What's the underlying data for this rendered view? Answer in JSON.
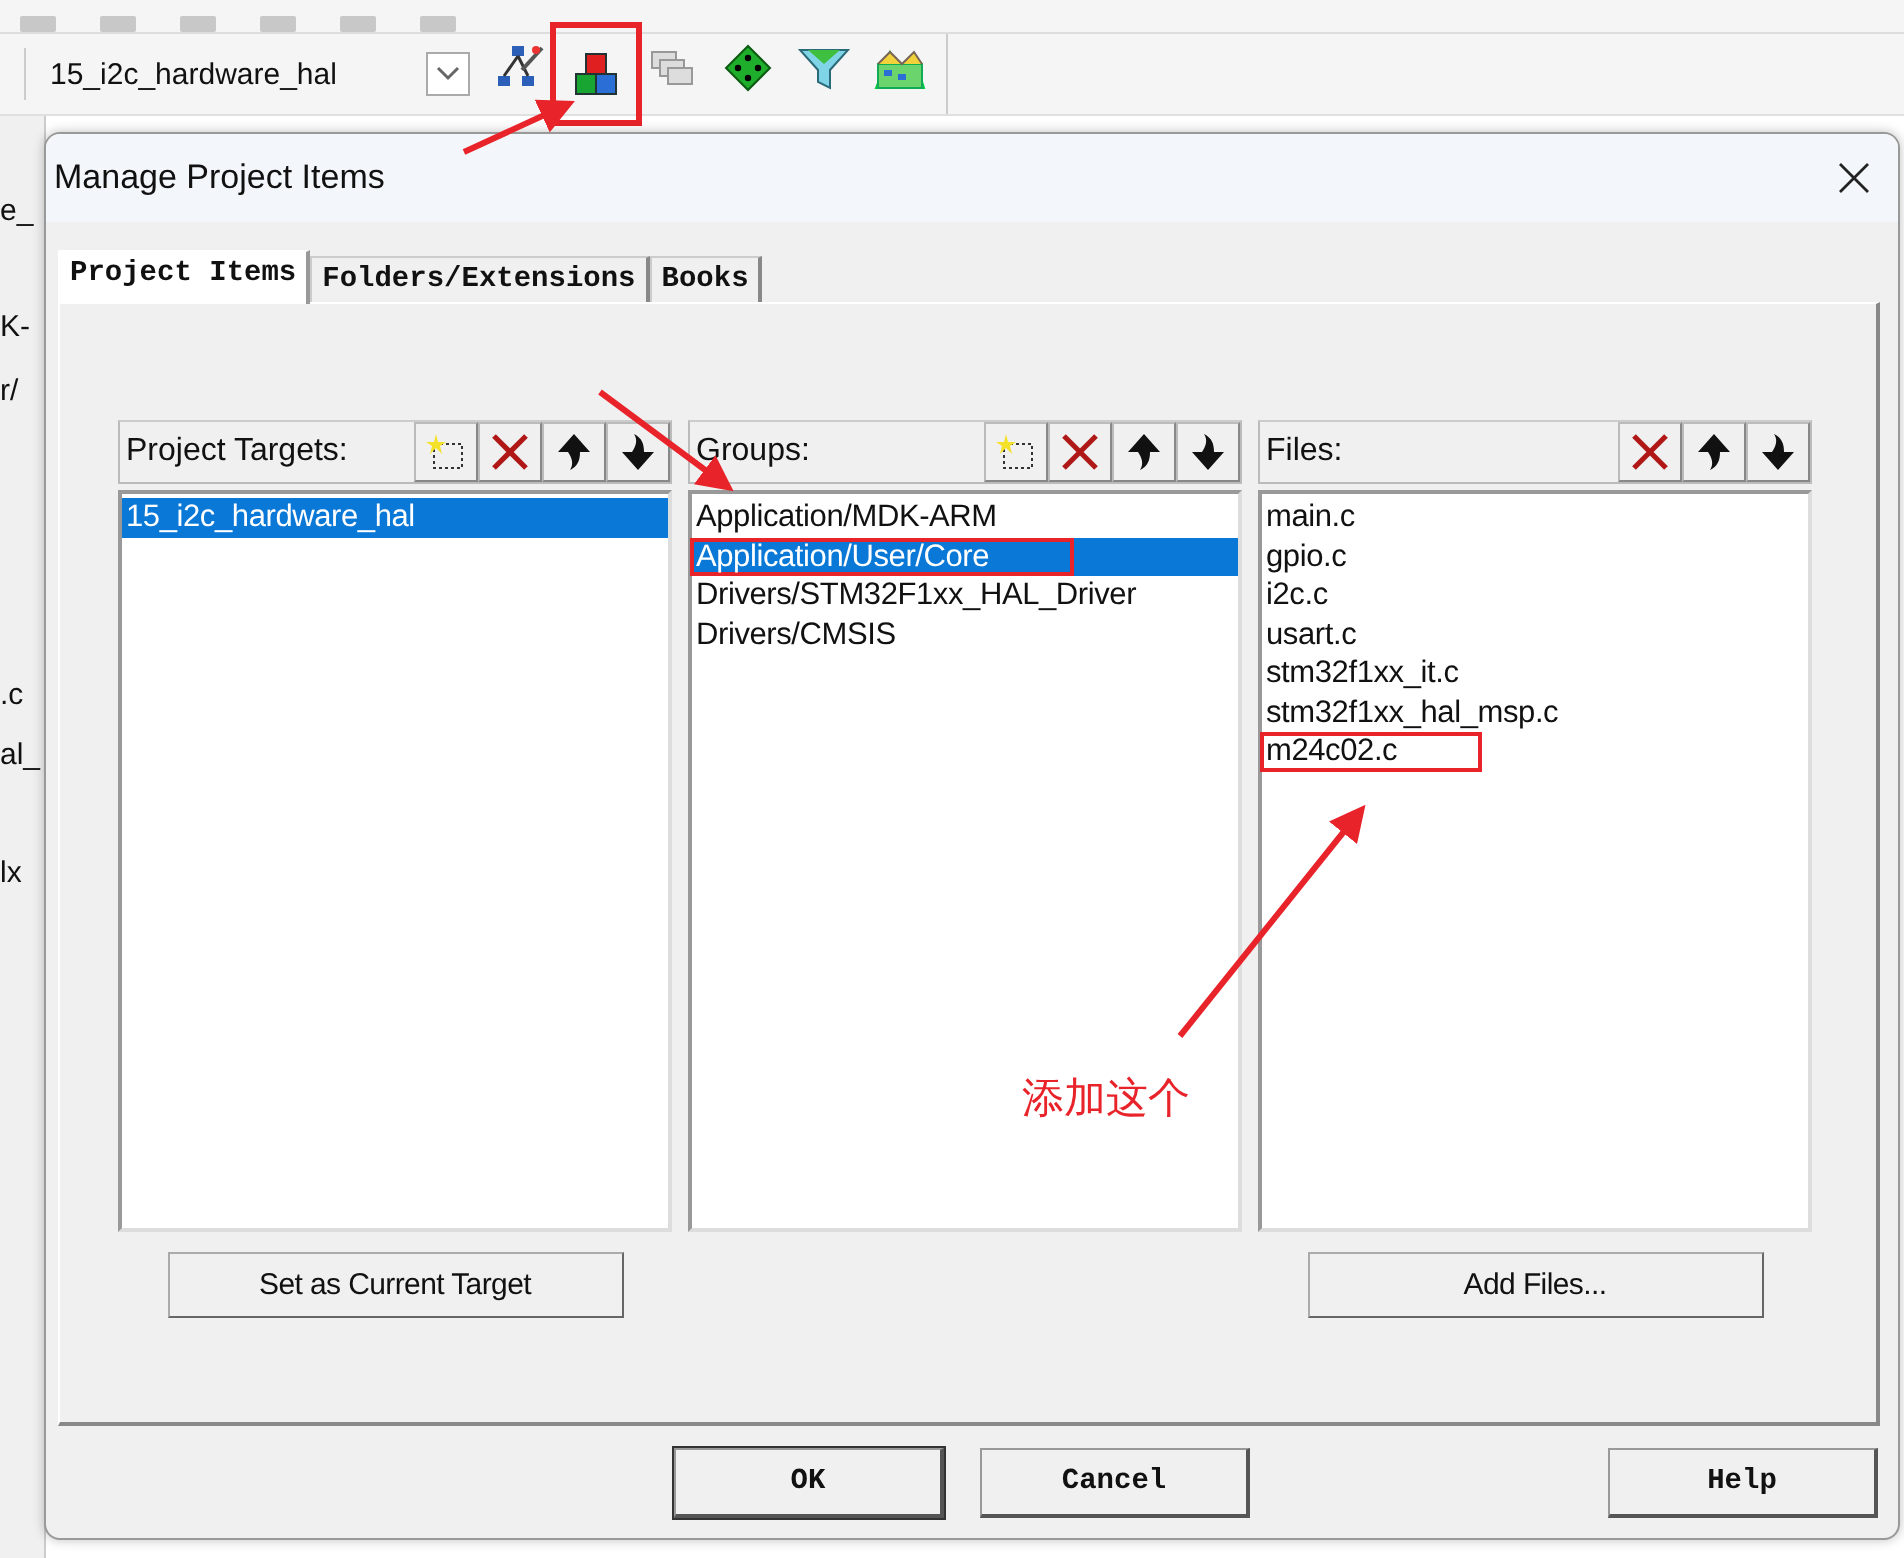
{
  "toolbar": {
    "target": "15_i2c_hardware_hal",
    "icons": [
      {
        "kind": "wand",
        "highlighted": false
      },
      {
        "kind": "blocks",
        "highlighted": true
      },
      {
        "kind": "stack",
        "highlighted": false
      },
      {
        "kind": "diamond",
        "highlighted": false
      },
      {
        "kind": "funnel",
        "highlighted": false
      },
      {
        "kind": "tiles",
        "highlighted": false
      }
    ]
  },
  "background_fragments": [
    "e_",
    "K-",
    "r/",
    ".c",
    "al_",
    "lx"
  ],
  "dialog": {
    "title": "Manage Project Items",
    "tabs": [
      {
        "label": "Project Items",
        "selected": true
      },
      {
        "label": "Folders/Extensions",
        "selected": false
      },
      {
        "label": "Books",
        "selected": false
      }
    ],
    "panels": [
      {
        "title": "Project Targets:",
        "tools": [
          {
            "kind": "new"
          },
          {
            "kind": "delete"
          },
          {
            "kind": "up"
          },
          {
            "kind": "down"
          }
        ],
        "items": [
          {
            "label": "15_i2c_hardware_hal",
            "selected": true,
            "highlighted": false
          }
        ],
        "button": "Set as Current Target"
      },
      {
        "title": "Groups:",
        "tools": [
          {
            "kind": "new"
          },
          {
            "kind": "delete"
          },
          {
            "kind": "up"
          },
          {
            "kind": "down"
          }
        ],
        "items": [
          {
            "label": "Application/MDK-ARM",
            "selected": false,
            "highlighted": false
          },
          {
            "label": "Application/User/Core",
            "selected": true,
            "highlighted": true
          },
          {
            "label": "Drivers/STM32F1xx_HAL_Driver",
            "selected": false,
            "highlighted": false
          },
          {
            "label": "Drivers/CMSIS",
            "selected": false,
            "highlighted": false
          }
        ]
      },
      {
        "title": "Files:",
        "tools": [
          {
            "kind": "delete"
          },
          {
            "kind": "up"
          },
          {
            "kind": "down"
          }
        ],
        "items": [
          {
            "label": "main.c",
            "selected": false,
            "highlighted": false
          },
          {
            "label": "gpio.c",
            "selected": false,
            "highlighted": false
          },
          {
            "label": "i2c.c",
            "selected": false,
            "highlighted": false
          },
          {
            "label": "usart.c",
            "selected": false,
            "highlighted": false
          },
          {
            "label": "stm32f1xx_it.c",
            "selected": false,
            "highlighted": false
          },
          {
            "label": "stm32f1xx_hal_msp.c",
            "selected": false,
            "highlighted": false
          },
          {
            "label": "m24c02.c",
            "selected": false,
            "highlighted": true
          }
        ],
        "button": "Add Files..."
      }
    ],
    "buttons": [
      "OK",
      "Cancel",
      "Help"
    ]
  },
  "annotation": {
    "text": "添加这个"
  }
}
